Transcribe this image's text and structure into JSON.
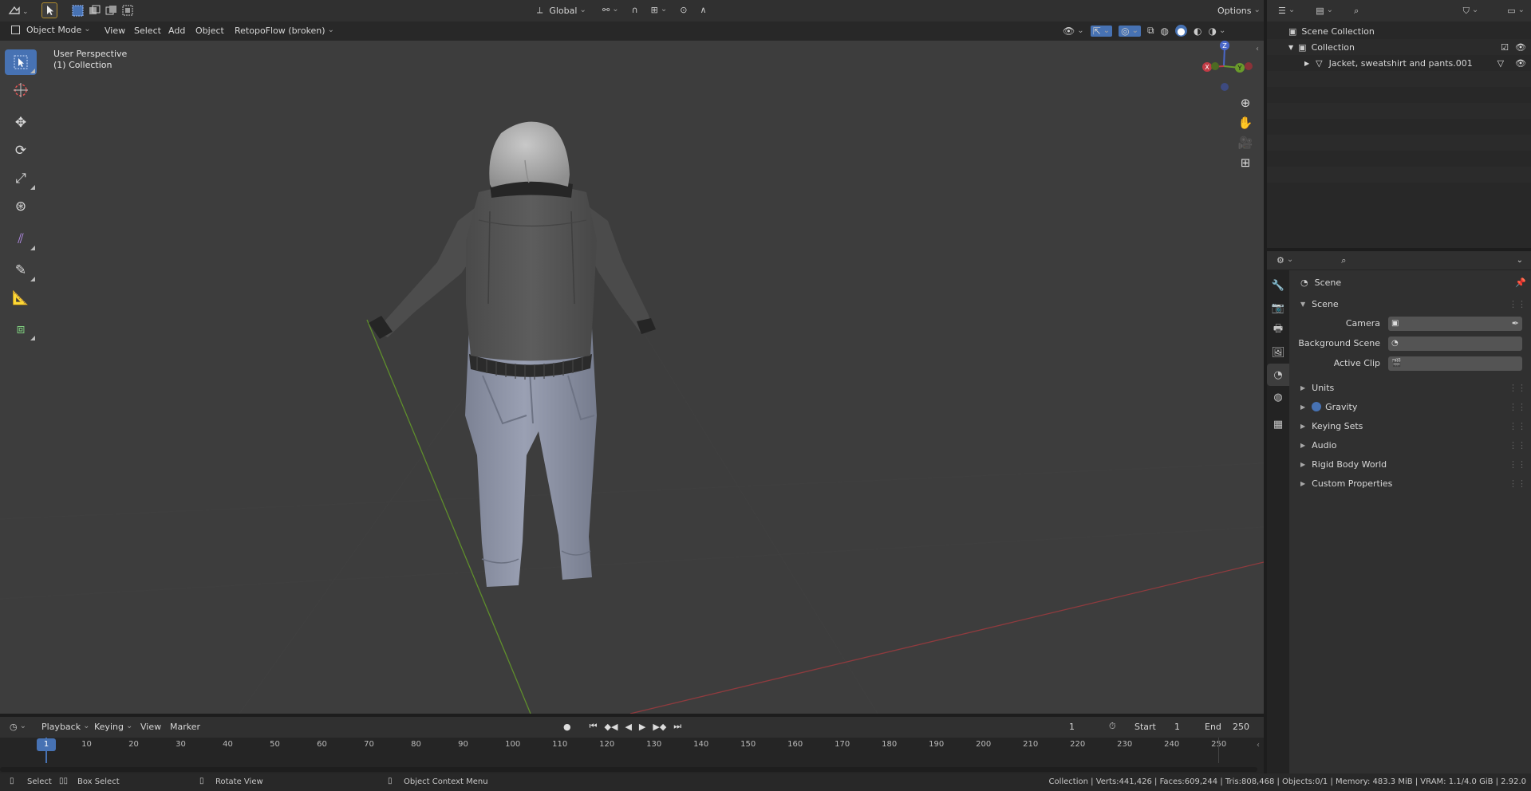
{
  "topbar": {
    "transform_orientation": "Global",
    "options_label": "Options"
  },
  "header": {
    "mode": "Object Mode",
    "menus": [
      "View",
      "Select",
      "Add",
      "Object"
    ],
    "addon_menu": "RetopoFlow (broken)"
  },
  "viewport": {
    "overlay_title": "User Perspective",
    "overlay_collection": "(1) Collection",
    "gizmo_axes": {
      "x": "X",
      "y": "Y",
      "z": "Z"
    },
    "colors": {
      "x_axis": "#c13b45",
      "y_axis": "#6a9b2b",
      "z_axis": "#4a67c8",
      "background": "#3d3d3d"
    }
  },
  "outliner": {
    "root": "Scene Collection",
    "collection": "Collection",
    "object": "Jacket, sweatshirt and pants.001"
  },
  "properties": {
    "context": "Scene",
    "panel_title": "Scene",
    "fields": [
      {
        "label": "Camera"
      },
      {
        "label": "Background Scene"
      },
      {
        "label": "Active Clip"
      }
    ],
    "subpanels": [
      "Units",
      "Gravity",
      "Keying Sets",
      "Audio",
      "Rigid Body World",
      "Custom Properties"
    ],
    "gravity_enabled": true
  },
  "timeline": {
    "menus": [
      "Playback",
      "Keying",
      "View",
      "Marker"
    ],
    "current_frame": "1",
    "start_label": "Start",
    "start": "1",
    "end_label": "End",
    "end": "250",
    "ticks": [
      "1",
      "10",
      "20",
      "30",
      "40",
      "50",
      "60",
      "70",
      "80",
      "90",
      "100",
      "110",
      "120",
      "130",
      "140",
      "150",
      "160",
      "170",
      "180",
      "190",
      "200",
      "210",
      "220",
      "230",
      "240",
      "250"
    ]
  },
  "status": {
    "select": "Select",
    "box_select": "Box Select",
    "rotate_view": "Rotate View",
    "context_menu": "Object Context Menu",
    "stats": "Collection | Verts:441,426 | Faces:609,244 | Tris:808,468 | Objects:0/1 | Memory: 483.3 MiB | VRAM: 1.1/4.0 GiB | 2.92.0"
  }
}
